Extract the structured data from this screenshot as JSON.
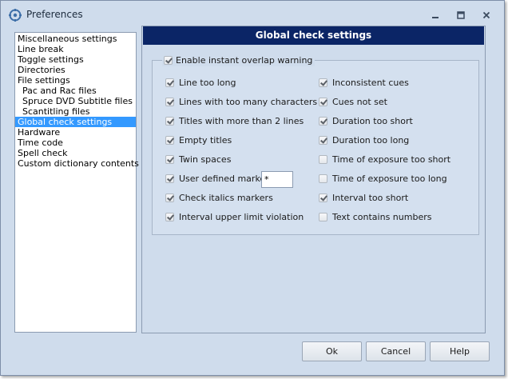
{
  "window": {
    "title": "Preferences"
  },
  "nav": {
    "items": [
      {
        "label": "Miscellaneous settings",
        "sub": false,
        "selected": false
      },
      {
        "label": "Line break",
        "sub": false,
        "selected": false
      },
      {
        "label": "Toggle settings",
        "sub": false,
        "selected": false
      },
      {
        "label": "Directories",
        "sub": false,
        "selected": false
      },
      {
        "label": "File settings",
        "sub": false,
        "selected": false
      },
      {
        "label": "Pac and Rac files",
        "sub": true,
        "selected": false
      },
      {
        "label": "Spruce DVD Subtitle files",
        "sub": true,
        "selected": false
      },
      {
        "label": "Scantitling files",
        "sub": true,
        "selected": false
      },
      {
        "label": "Global check settings",
        "sub": false,
        "selected": true
      },
      {
        "label": "Hardware",
        "sub": false,
        "selected": false
      },
      {
        "label": "Time code",
        "sub": false,
        "selected": false
      },
      {
        "label": "Spell check",
        "sub": false,
        "selected": false
      },
      {
        "label": "Custom dictionary contents",
        "sub": false,
        "selected": false
      }
    ]
  },
  "panel": {
    "header": "Global check settings",
    "overlap_warning": {
      "label": "Enable instant overlap warning",
      "checked": true
    },
    "left_checks": [
      {
        "label": "Line too long",
        "checked": true
      },
      {
        "label": "Lines with too many characters",
        "checked": true
      },
      {
        "label": "Titles with more than 2 lines",
        "checked": true
      },
      {
        "label": "Empty titles",
        "checked": true
      },
      {
        "label": "Twin spaces",
        "checked": true
      },
      {
        "label": "User defined marke",
        "checked": true
      },
      {
        "label": "Check italics markers",
        "checked": true
      },
      {
        "label": "Interval upper limit violation",
        "checked": true
      }
    ],
    "right_checks": [
      {
        "label": "Inconsistent cues",
        "checked": true
      },
      {
        "label": "Cues not set",
        "checked": true
      },
      {
        "label": "Duration too short",
        "checked": true
      },
      {
        "label": "Duration too long",
        "checked": true
      },
      {
        "label": "Time of exposure too short",
        "checked": false
      },
      {
        "label": "Time of exposure too long",
        "checked": false
      },
      {
        "label": "Interval too short",
        "checked": true
      },
      {
        "label": "Text contains numbers",
        "checked": false
      }
    ],
    "user_marker_value": "*"
  },
  "buttons": {
    "ok": "Ok",
    "cancel": "Cancel",
    "help": "Help"
  },
  "colors": {
    "header_bg": "#0b2566",
    "selection": "#3399ff",
    "window_bg": "#cfdcec"
  }
}
